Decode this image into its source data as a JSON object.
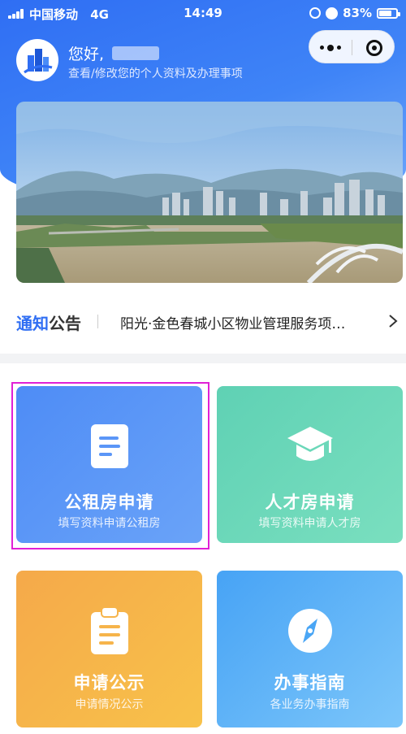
{
  "status_bar": {
    "carrier": "中国移动",
    "network": "4G",
    "time": "14:49",
    "battery": "83%",
    "battery_level": 0.83,
    "icons": [
      "signal-icon",
      "rotation-lock-icon",
      "alarm-icon",
      "battery-icon"
    ]
  },
  "header": {
    "greeting": "您好,",
    "subtitle": "查看/修改您的个人资料及办理事项",
    "capsule_icons": [
      "more-icon",
      "close-mini-program-icon"
    ]
  },
  "notice": {
    "label_highlight": "通知",
    "label_rest": "公告",
    "text": "阳光·金色春城小区物业管理服务项…"
  },
  "cards": [
    {
      "title": "公租房申请",
      "subtitle": "填写资料申请公租房",
      "icon": "document-icon",
      "color": "#4e8cf6"
    },
    {
      "title": "人才房申请",
      "subtitle": "填写资料申请人才房",
      "icon": "graduation-cap-icon",
      "color": "#5fd1b4"
    },
    {
      "title": "申请公示",
      "subtitle": "申请情况公示",
      "icon": "clipboard-icon",
      "color": "#f5a94a"
    },
    {
      "title": "办事指南",
      "subtitle": "各业务办事指南",
      "icon": "compass-icon",
      "color": "#47a3f5"
    }
  ],
  "colors": {
    "primary": "#2f6ef3",
    "highlight_border": "#e020d6"
  }
}
